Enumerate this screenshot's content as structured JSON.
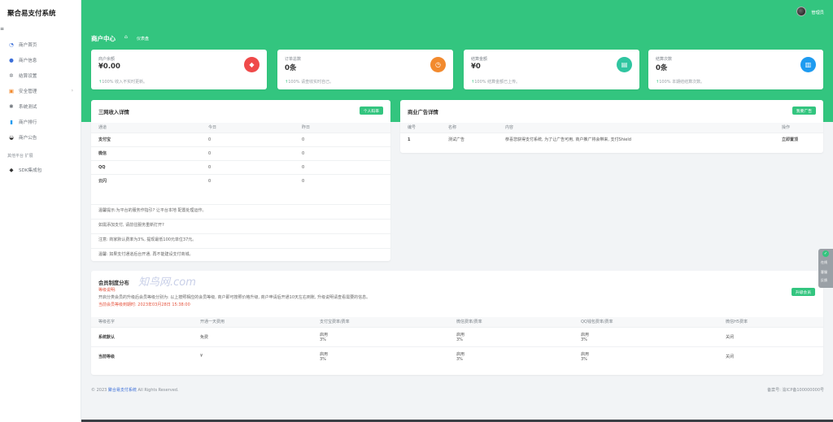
{
  "app": {
    "title": "聚合易支付系统"
  },
  "sidebar": {
    "items": [
      {
        "label": "商户首页",
        "icon": "dashboard-icon",
        "glyph": "◔"
      },
      {
        "label": "商户信息",
        "icon": "user-icon",
        "glyph": "●"
      },
      {
        "label": "结算设置",
        "icon": "gear-icon",
        "glyph": "✲"
      },
      {
        "label": "安全管理",
        "icon": "shield-icon",
        "glyph": "▣"
      },
      {
        "label": "系统测试",
        "icon": "cog-icon",
        "glyph": "✱"
      },
      {
        "label": "商户排行",
        "icon": "bar-chart-icon",
        "glyph": "▮"
      },
      {
        "label": "商户公告",
        "icon": "announce-icon",
        "glyph": "◒"
      }
    ],
    "section": "其他平台 扩展",
    "extra": {
      "label": "SDK集成包",
      "icon": "diamond-icon",
      "glyph": "◆"
    }
  },
  "header": {
    "user": "管理员",
    "page_title": "商户中心",
    "breadcrumb": "仪表盘"
  },
  "stats": [
    {
      "label": "商户余额",
      "value": "¥0.00",
      "note": "100% 收入不实时更新。",
      "color": "#ef4a4a",
      "icon": "diamond-icon",
      "glyph": "◆"
    },
    {
      "label": "订单总数",
      "value": "0条",
      "note": "100% 请查收实时自己。",
      "color": "#f28a2e",
      "icon": "clock-icon",
      "glyph": "◷"
    },
    {
      "label": "结算金额",
      "value": "¥0",
      "note": "100% 结算金额已上传。",
      "color": "#2fc5a0",
      "icon": "card-icon",
      "glyph": "▤"
    },
    {
      "label": "结算次数",
      "value": "0条",
      "note": "100% 本期结结算次数。",
      "color": "#1e9bf0",
      "icon": "chart-icon",
      "glyph": "▥"
    }
  ],
  "income": {
    "title": "三网收入详情",
    "button": "个人码率",
    "columns": [
      "通道",
      "今日",
      "昨日"
    ],
    "rows": [
      {
        "name": "支付宝",
        "today": "0",
        "yesterday": "0"
      },
      {
        "name": "微信",
        "today": "0",
        "yesterday": "0"
      },
      {
        "name": "QQ",
        "today": "0",
        "yesterday": "0"
      },
      {
        "name": "云闪",
        "today": "0",
        "yesterday": "0"
      }
    ],
    "notes": [
      "温馨提示:为平台的服务作指引? 让平台本地 配置处理运作。",
      "如需添加支付, 请前往服务重新打开?",
      "注意: 商家默认费率为3%, 提现最低100元单位37元。",
      "温馨: 如果支付通道后台开通, 再不能建设支付商城。"
    ]
  },
  "ads": {
    "title": "商业广告详情",
    "button": "我要广告",
    "columns": [
      "编号",
      "名称",
      "内容",
      "操作"
    ],
    "rows": [
      {
        "no": "1",
        "name": "测试广告",
        "content": "恭喜您获得支付系统, 为了让广告可用, 商户推广将会带来, 支付Shield",
        "action": "立即置顶"
      }
    ]
  },
  "member": {
    "title": "会员制度分布",
    "watermark": "知鸟网.com",
    "lines": [
      "等级说明:",
      "开启分类会员的升级后会员等级分别为: 以上按照相应的会员等级, 商户即可按照价格升级, 商户申请后开通10天左右到账, 升级说明请查看需要的信息。",
      "当前会员等级到期时: 2023年03月28日 15:38:00"
    ],
    "button": "升级会员",
    "columns": [
      "等级名字",
      "开通一天费用",
      "支付宝费率/费率",
      "微信费率/费率",
      "QQ钱包费率/费率",
      "微信H5费率"
    ],
    "rows": [
      {
        "name": "系统默认",
        "price": "免费",
        "alipay": "启用",
        "alipay_rate": "3%",
        "wx": "启用",
        "wx_rate": "3%",
        "qq": "启用",
        "qq_rate": "3%",
        "h5": "关闭"
      },
      {
        "name": "当前等级",
        "price": "¥",
        "alipay": "启用",
        "alipay_rate": "3%",
        "wx": "启用",
        "wx_rate": "3%",
        "qq": "启用",
        "qq_rate": "3%",
        "h5": "关闭"
      }
    ]
  },
  "footer": {
    "copyright": "© 2023",
    "brand": "聚合易支付系统",
    "rights": "All Rights Reserved.",
    "icp": "备案号: 渝ICP备100000000号"
  },
  "widget": {
    "a": "在线",
    "b": "客服",
    "c": "反馈"
  }
}
